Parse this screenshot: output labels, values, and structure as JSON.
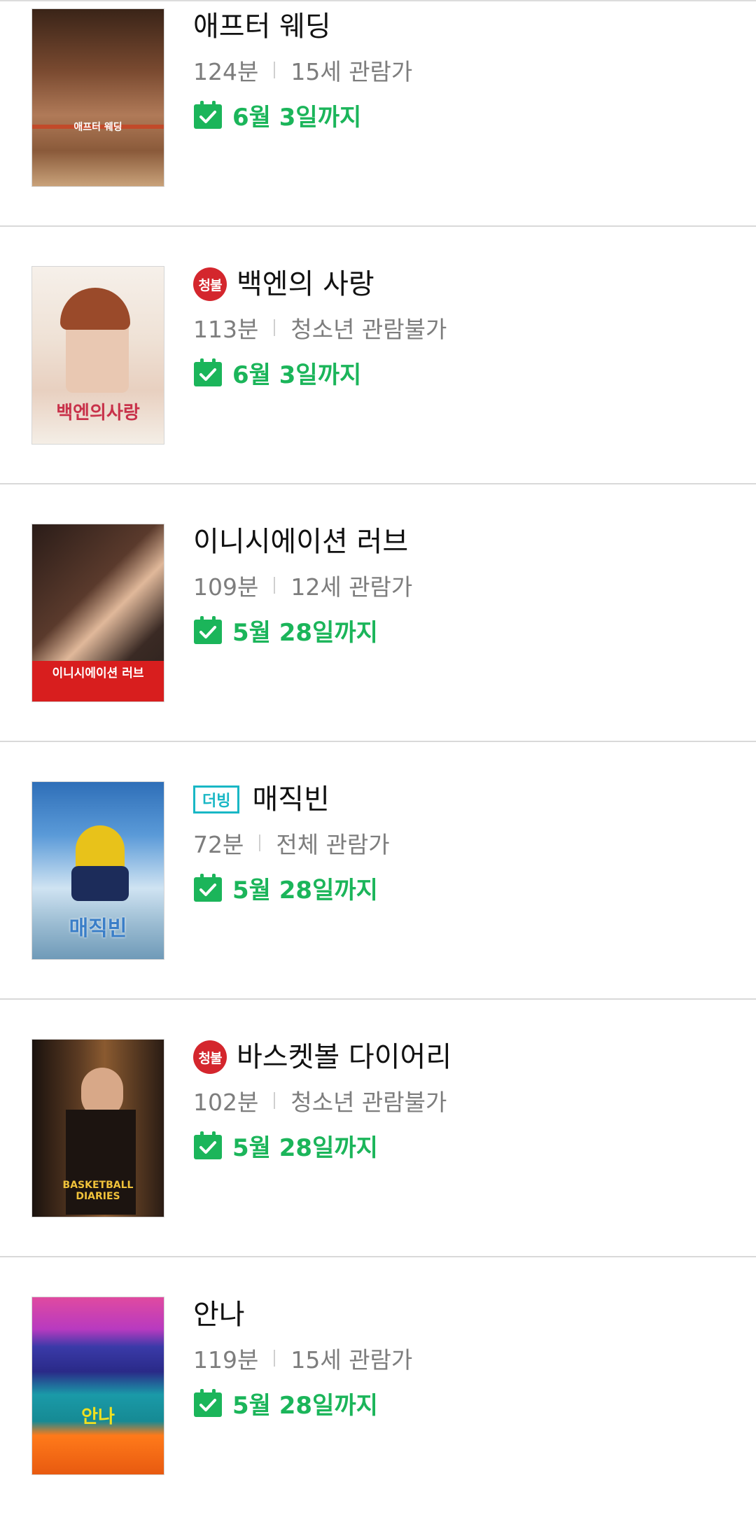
{
  "colors": {
    "accent_green": "#1bb55a",
    "age_badge_red": "#d4262d",
    "dub_badge_teal": "#19b7c5",
    "meta_gray": "#7d7d7d"
  },
  "movies": [
    {
      "title": "애프터 웨딩",
      "badge": null,
      "runtime": "124분",
      "rating": "15세 관람가",
      "until": "6월 3일까지",
      "poster_text": "애프터 웨딩",
      "poster_colors": [
        "#5a3a28",
        "#c9a27a",
        "#8a5a3a"
      ]
    },
    {
      "title": "백엔의 사랑",
      "badge": "청불",
      "runtime": "113분",
      "rating": "청소년 관람불가",
      "until": "6월 3일까지",
      "poster_text": "백엔의사랑",
      "poster_colors": [
        "#f4eee6",
        "#d8b7a3",
        "#c8324a"
      ]
    },
    {
      "title": "이니시에이션 러브",
      "badge": null,
      "runtime": "109분",
      "rating": "12세 관람가",
      "until": "5월 28일까지",
      "poster_text": "이니시에이션 러브",
      "poster_colors": [
        "#3a2a24",
        "#e8c8b0",
        "#d81e1e"
      ]
    },
    {
      "title": "매직빈",
      "badge": "더빙",
      "runtime": "72분",
      "rating": "전체 관람가",
      "until": "5월 28일까지",
      "poster_text": "매직빈",
      "poster_colors": [
        "#3a7ec8",
        "#cfe3f2",
        "#6f9ab8"
      ]
    },
    {
      "title": "바스켓볼 다이어리",
      "badge": "청불",
      "runtime": "102분",
      "rating": "청소년 관람불가",
      "until": "5월 28일까지",
      "poster_text": "BASKETBALL DIARIES",
      "poster_colors": [
        "#2a1c14",
        "#8a5a30",
        "#f0c23a"
      ]
    },
    {
      "title": "안나",
      "badge": null,
      "runtime": "119분",
      "rating": "15세 관람가",
      "until": "5월 28일까지",
      "poster_text": "안나",
      "poster_colors": [
        "#e04aa0",
        "#3a3aa8",
        "#ff7a1a"
      ]
    }
  ]
}
